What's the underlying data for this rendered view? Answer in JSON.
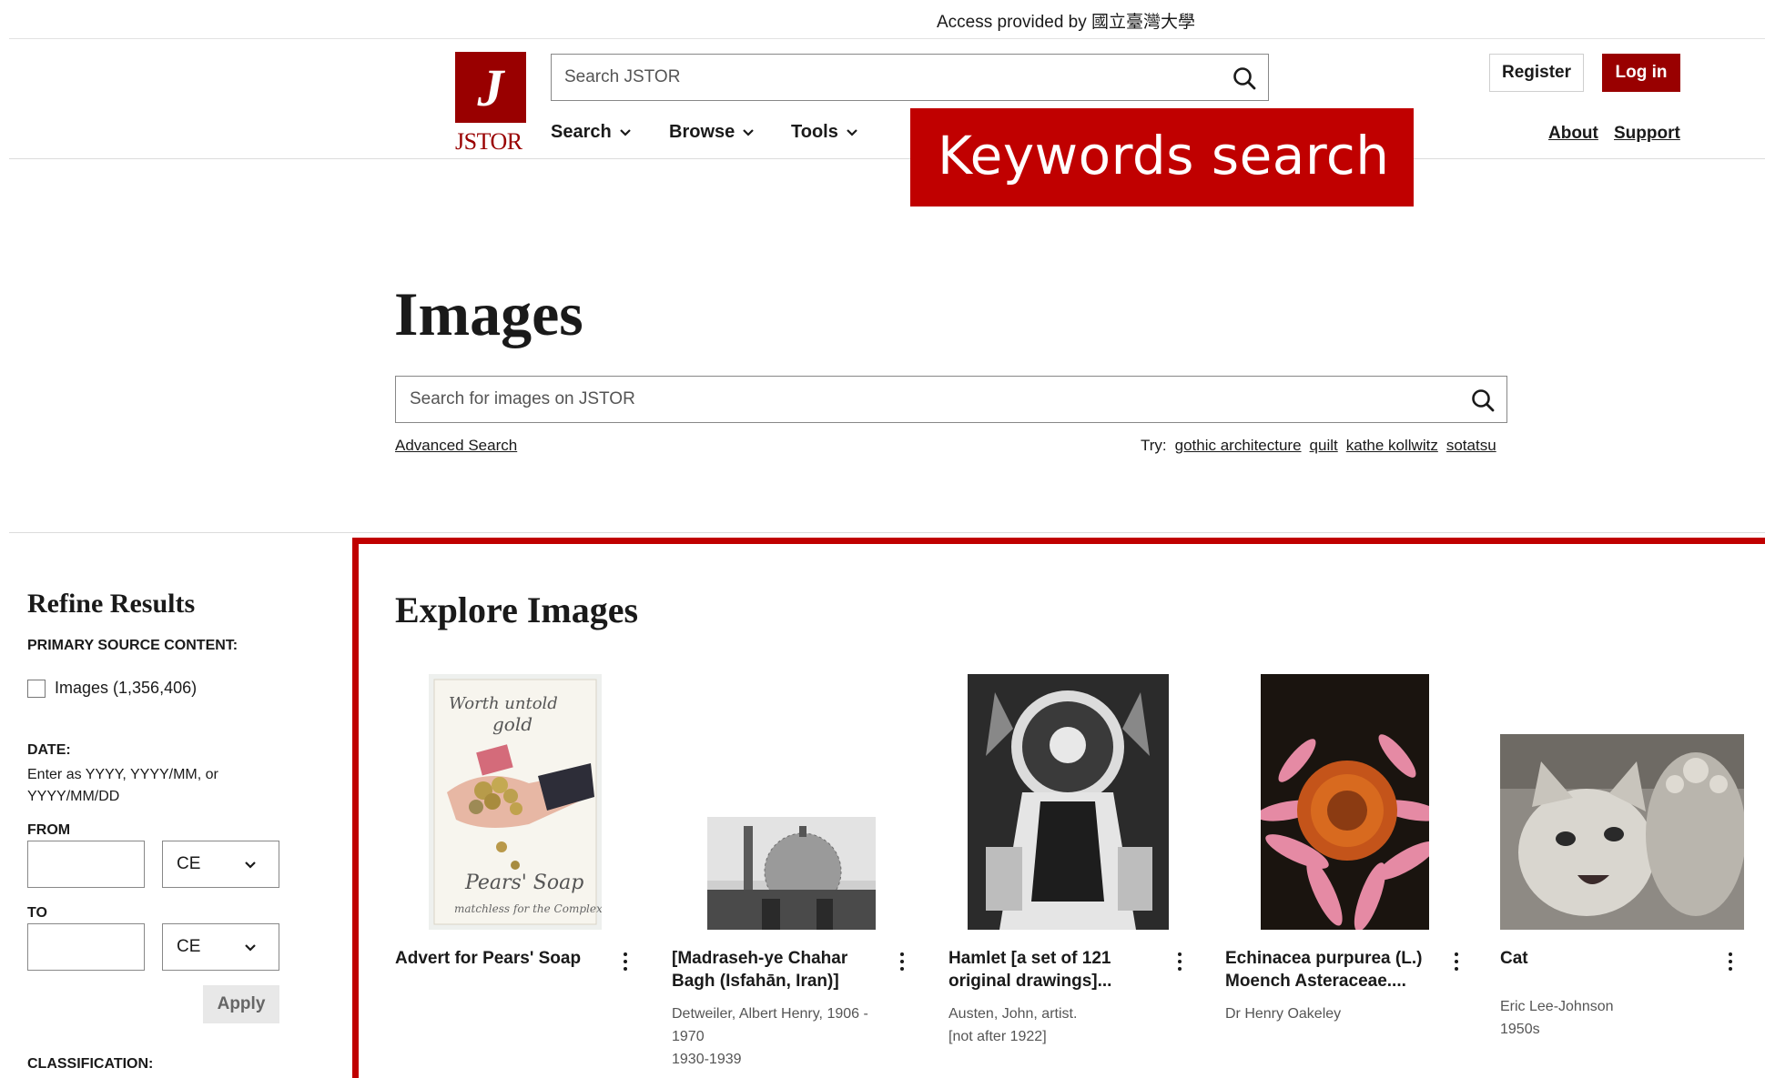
{
  "access_bar": {
    "text": "Access provided by 國立臺灣大學"
  },
  "header": {
    "logo_text": "JSTOR",
    "search_placeholder": "Search JSTOR",
    "register_label": "Register",
    "login_label": "Log in",
    "nav": [
      {
        "label": "Search"
      },
      {
        "label": "Browse"
      },
      {
        "label": "Tools"
      }
    ],
    "about_label": "About",
    "support_label": "Support"
  },
  "callout": {
    "text": "Keywords search"
  },
  "hero": {
    "title": "Images",
    "search_placeholder": "Search for images on JSTOR",
    "advanced_label": "Advanced Search",
    "try_label": "Try:",
    "suggestions": [
      "gothic architecture",
      "quilt",
      "kathe kollwitz",
      "sotatsu"
    ]
  },
  "sidebar": {
    "title": "Refine Results",
    "primary_heading": "PRIMARY SOURCE CONTENT:",
    "images_checkbox_label": "Images (1,356,406)",
    "date_heading": "DATE:",
    "date_hint": "Enter as YYYY, YYYY/MM, or YYYY/MM/DD",
    "from_label": "FROM",
    "to_label": "TO",
    "from_era": "CE",
    "to_era": "CE",
    "apply_label": "Apply",
    "classification_heading": "CLASSIFICATION:"
  },
  "explore": {
    "title": "Explore Images",
    "cards": [
      {
        "title": "Advert for Pears' Soap",
        "meta": []
      },
      {
        "title": "[Madraseh-ye Chahar Bagh (Isfahān, Iran)]",
        "meta": [
          "Detweiler, Albert Henry, 1906 - 1970",
          "1930-1939"
        ]
      },
      {
        "title": "Hamlet [a set of 121 original drawings]...",
        "meta": [
          "Austen, John, artist.",
          "[not after 1922]"
        ]
      },
      {
        "title": "Echinacea purpurea (L.) Moench Asteraceae....",
        "meta": [
          "Dr Henry Oakeley"
        ]
      },
      {
        "title": "Cat",
        "meta": [
          "Eric Lee-Johnson",
          "1950s"
        ]
      }
    ]
  },
  "colors": {
    "brand": "#990000",
    "callout": "#c00000"
  }
}
